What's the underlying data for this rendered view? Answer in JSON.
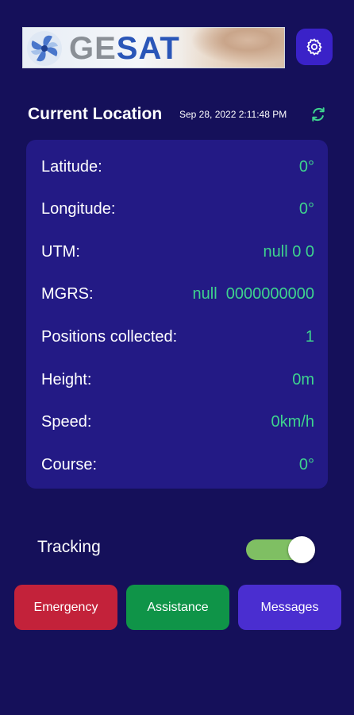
{
  "header": {
    "logo_text_part1": "GE",
    "logo_text_part2": "SAT",
    "settings_icon": "gear-icon"
  },
  "location": {
    "title": "Current Location",
    "timestamp": "Sep 28, 2022 2:11:48 PM",
    "refresh_icon": "refresh-icon",
    "rows": [
      {
        "label": "Latitude:",
        "value": "0°"
      },
      {
        "label": "Longitude:",
        "value": "0°"
      },
      {
        "label": "UTM:",
        "value": "null 0 0"
      },
      {
        "label": "MGRS:",
        "value": "null  0000000000"
      },
      {
        "label": "Positions collected:",
        "value": "1"
      },
      {
        "label": "Height:",
        "value": "0m"
      },
      {
        "label": "Speed:",
        "value": "0km/h"
      },
      {
        "label": "Course:",
        "value": "0°"
      }
    ]
  },
  "tracking": {
    "label": "Tracking",
    "enabled": true
  },
  "actions": {
    "emergency": "Emergency",
    "assistance": "Assistance",
    "messages": "Messages"
  },
  "colors": {
    "background": "#15105a",
    "card": "#231a85",
    "value_green": "#3ed38e",
    "emergency": "#c3223a",
    "assistance": "#0f9448",
    "messages": "#4a2ed0"
  }
}
